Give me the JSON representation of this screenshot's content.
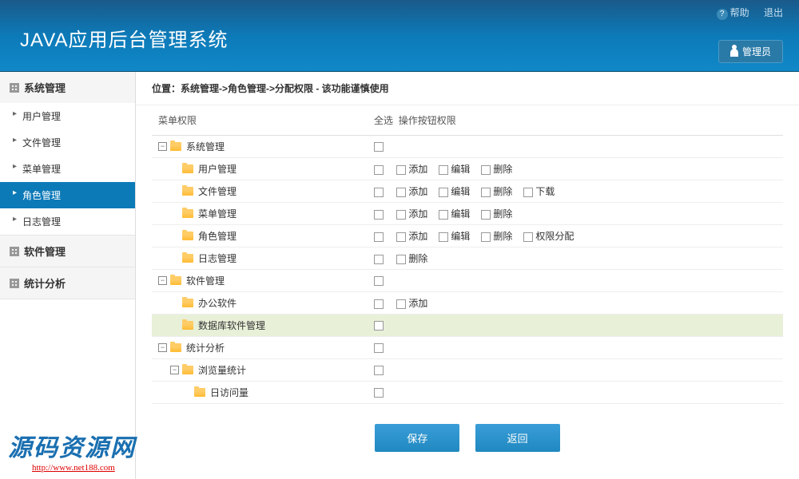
{
  "header": {
    "title": "JAVA应用后台管理系统",
    "help": "帮助",
    "logout": "退出",
    "user": "管理员"
  },
  "sidebar": {
    "groups": [
      {
        "title": "系统管理",
        "expanded": true,
        "items": [
          {
            "label": "用户管理",
            "active": false
          },
          {
            "label": "文件管理",
            "active": false
          },
          {
            "label": "菜单管理",
            "active": false
          },
          {
            "label": "角色管理",
            "active": true
          },
          {
            "label": "日志管理",
            "active": false
          }
        ]
      },
      {
        "title": "软件管理",
        "expanded": false,
        "items": []
      },
      {
        "title": "统计分析",
        "expanded": false,
        "items": []
      }
    ]
  },
  "breadcrumb": "位置：系统管理->角色管理->分配权限 - 该功能谨慎使用",
  "table": {
    "col_menu": "菜单权限",
    "col_all": "全选",
    "col_actions": "操作按钮权限"
  },
  "actions": {
    "add": "添加",
    "edit": "编辑",
    "delete": "删除",
    "download": "下载",
    "assign": "权限分配"
  },
  "tree": [
    {
      "depth": 0,
      "toggle": "-",
      "label": "系统管理",
      "ops": [],
      "hl": false
    },
    {
      "depth": 1,
      "toggle": "",
      "label": "用户管理",
      "ops": [
        "add",
        "edit",
        "delete"
      ],
      "hl": false
    },
    {
      "depth": 1,
      "toggle": "",
      "label": "文件管理",
      "ops": [
        "add",
        "edit",
        "delete",
        "download"
      ],
      "hl": false
    },
    {
      "depth": 1,
      "toggle": "",
      "label": "菜单管理",
      "ops": [
        "add",
        "edit",
        "delete"
      ],
      "hl": false
    },
    {
      "depth": 1,
      "toggle": "",
      "label": "角色管理",
      "ops": [
        "add",
        "edit",
        "delete",
        "assign"
      ],
      "hl": false
    },
    {
      "depth": 1,
      "toggle": "",
      "label": "日志管理",
      "ops": [
        "delete"
      ],
      "hl": false
    },
    {
      "depth": 0,
      "toggle": "-",
      "label": "软件管理",
      "ops": [],
      "hl": false
    },
    {
      "depth": 1,
      "toggle": "",
      "label": "办公软件",
      "ops": [
        "add"
      ],
      "hl": false
    },
    {
      "depth": 1,
      "toggle": "",
      "label": "数据库软件管理",
      "ops": [],
      "hl": true
    },
    {
      "depth": 0,
      "toggle": "-",
      "label": "统计分析",
      "ops": [],
      "hl": false
    },
    {
      "depth": 1,
      "toggle": "-",
      "label": "浏览量统计",
      "ops": [],
      "hl": false
    },
    {
      "depth": 2,
      "toggle": "",
      "label": "日访问量",
      "ops": [],
      "hl": false
    }
  ],
  "buttons": {
    "save": "保存",
    "back": "返回"
  },
  "watermark": {
    "text": "源码资源网",
    "url": "http://www.net188.com"
  }
}
